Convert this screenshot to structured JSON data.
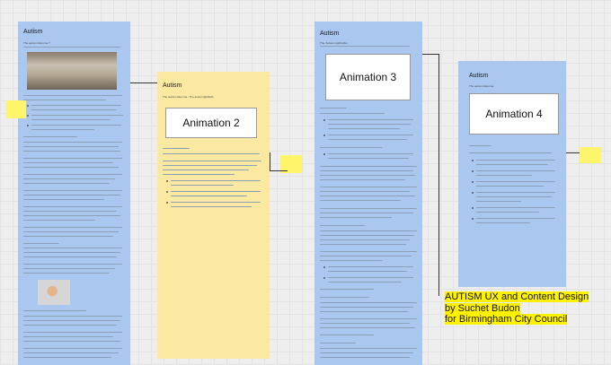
{
  "panels": {
    "p1": {
      "title": "Autism",
      "subtitle": "The autism dilemma ?"
    },
    "p2": {
      "title": "Autism",
      "subtitle": "The autism dilemma - The autism lightbulb",
      "animation": "Animation 2"
    },
    "p3": {
      "title": "Autism",
      "subtitle": "The 'Autism Lightbulbs'",
      "animation": "Animation 3"
    },
    "p4": {
      "title": "Autism",
      "subtitle": "The autism dilemma",
      "animation": "Animation 4"
    }
  },
  "headline": {
    "line1": "AUTISM UX and Content Design",
    "line2": "by Suchet Budon",
    "line3": "for Birmingham City Council"
  },
  "colors": {
    "panel_blue": "#a9c7ef",
    "panel_yellow": "#fbe9a1",
    "sticky": "#fff56a",
    "highlight": "#fff200"
  }
}
